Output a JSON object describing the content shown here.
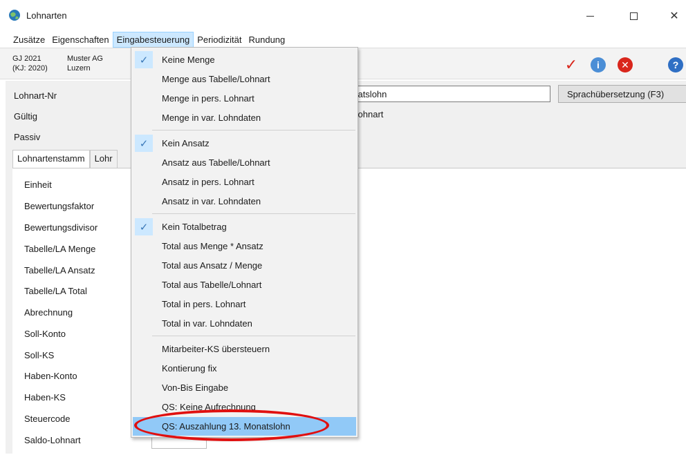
{
  "window": {
    "title": "Lohnarten",
    "icon": "globe-app-icon"
  },
  "menubar": [
    "Zusätze",
    "Eigenschaften",
    "Eingabesteuerung",
    "Periodizität",
    "Rundung"
  ],
  "infobar": {
    "gj_line1": "GJ 2021",
    "gj_line2": "(KJ: 2020)",
    "firma_line1": "Muster AG",
    "firma_line2": "Luzern",
    "toolbar_icons": [
      "check-icon",
      "info-icon",
      "cancel-icon",
      "help-icon"
    ]
  },
  "form": {
    "lohnart_label": "Lohnart-Nr",
    "lohnart_value": "onatslohn",
    "gueltig_label": "Gültig",
    "gueltig_value": "-Lohnart",
    "passiv_label": "Passiv",
    "translate_button": "Sprachübersetzung (F3)"
  },
  "tabs": [
    "Lohnartenstamm",
    "Lohr"
  ],
  "stamm_fields": [
    "Einheit",
    "Bewertungsfaktor",
    "Bewertungsdivisor",
    "Tabelle/LA Menge",
    "Tabelle/LA Ansatz",
    "Tabelle/LA Total",
    "Abrechnung",
    "Soll-Konto",
    "Soll-KS",
    "Haben-Konto",
    "Haben-KS",
    "Steuercode",
    "Saldo-Lohnart"
  ],
  "dropdown": {
    "items": [
      {
        "label": "Keine Menge",
        "checked": true
      },
      {
        "label": "Menge aus Tabelle/Lohnart",
        "checked": false
      },
      {
        "label": "Menge in pers. Lohnart",
        "checked": false
      },
      {
        "label": "Menge in var. Lohndaten",
        "checked": false
      },
      {
        "label": "Kein Ansatz",
        "checked": true
      },
      {
        "label": "Ansatz aus Tabelle/Lohnart",
        "checked": false
      },
      {
        "label": "Ansatz in pers. Lohnart",
        "checked": false
      },
      {
        "label": "Ansatz in var. Lohndaten",
        "checked": false
      },
      {
        "label": "Kein Totalbetrag",
        "checked": true
      },
      {
        "label": "Total aus Menge * Ansatz",
        "checked": false
      },
      {
        "label": "Total aus Ansatz / Menge",
        "checked": false
      },
      {
        "label": "Total aus Tabelle/Lohnart",
        "checked": false
      },
      {
        "label": "Total in pers. Lohnart",
        "checked": false
      },
      {
        "label": "Total in var. Lohndaten",
        "checked": false
      },
      {
        "label": "Mitarbeiter-KS übersteuern",
        "checked": false
      },
      {
        "label": "Kontierung fix",
        "checked": false
      },
      {
        "label": "Von-Bis Eingabe",
        "checked": false
      },
      {
        "label": "QS: Keine Aufrechnung",
        "checked": false
      },
      {
        "label": "QS: Auszahlung 13. Monatslohn",
        "checked": false,
        "highlighted": true
      }
    ]
  },
  "colors": {
    "highlight": "#91c9f7",
    "check_bg": "#cce8ff",
    "annotation_red": "#e01010"
  }
}
